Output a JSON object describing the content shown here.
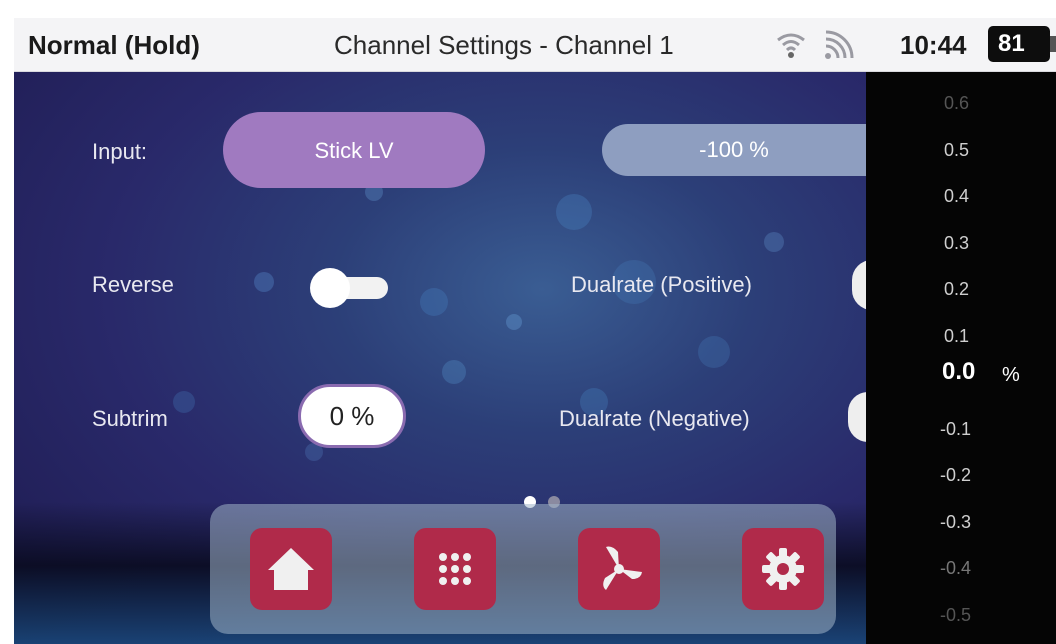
{
  "status_bar": {
    "mode": "Normal (Hold)",
    "title": "Channel Settings - Channel 1",
    "time": "10:44",
    "battery": "81"
  },
  "settings": {
    "input_label": "Input:",
    "input_source": "Stick LV",
    "input_value": "-100 %",
    "reverse_label": "Reverse",
    "reverse_on": false,
    "subtrim_label": "Subtrim",
    "subtrim_value": "0 %",
    "dualrate_positive_label": "Dualrate (Positive)",
    "dualrate_negative_label": "Dualrate (Negative)"
  },
  "pager": {
    "count": 2,
    "active": 0
  },
  "dock": [
    {
      "icon": "home-icon"
    },
    {
      "icon": "apps-grid-icon"
    },
    {
      "icon": "propeller-icon"
    },
    {
      "icon": "gear-icon"
    }
  ],
  "value_scale": {
    "ticks_above": [
      "0.6",
      "0.5",
      "0.4",
      "0.3",
      "0.2",
      "0.1"
    ],
    "current": "0.0",
    "unit": "%",
    "ticks_below": [
      "-0.1",
      "-0.2",
      "-0.3",
      "-0.4",
      "-0.5"
    ]
  },
  "colors": {
    "accent_purple": "#a07ac0",
    "dock_button": "#b02a4a",
    "status_bar_bg": "#f4f4f6"
  }
}
